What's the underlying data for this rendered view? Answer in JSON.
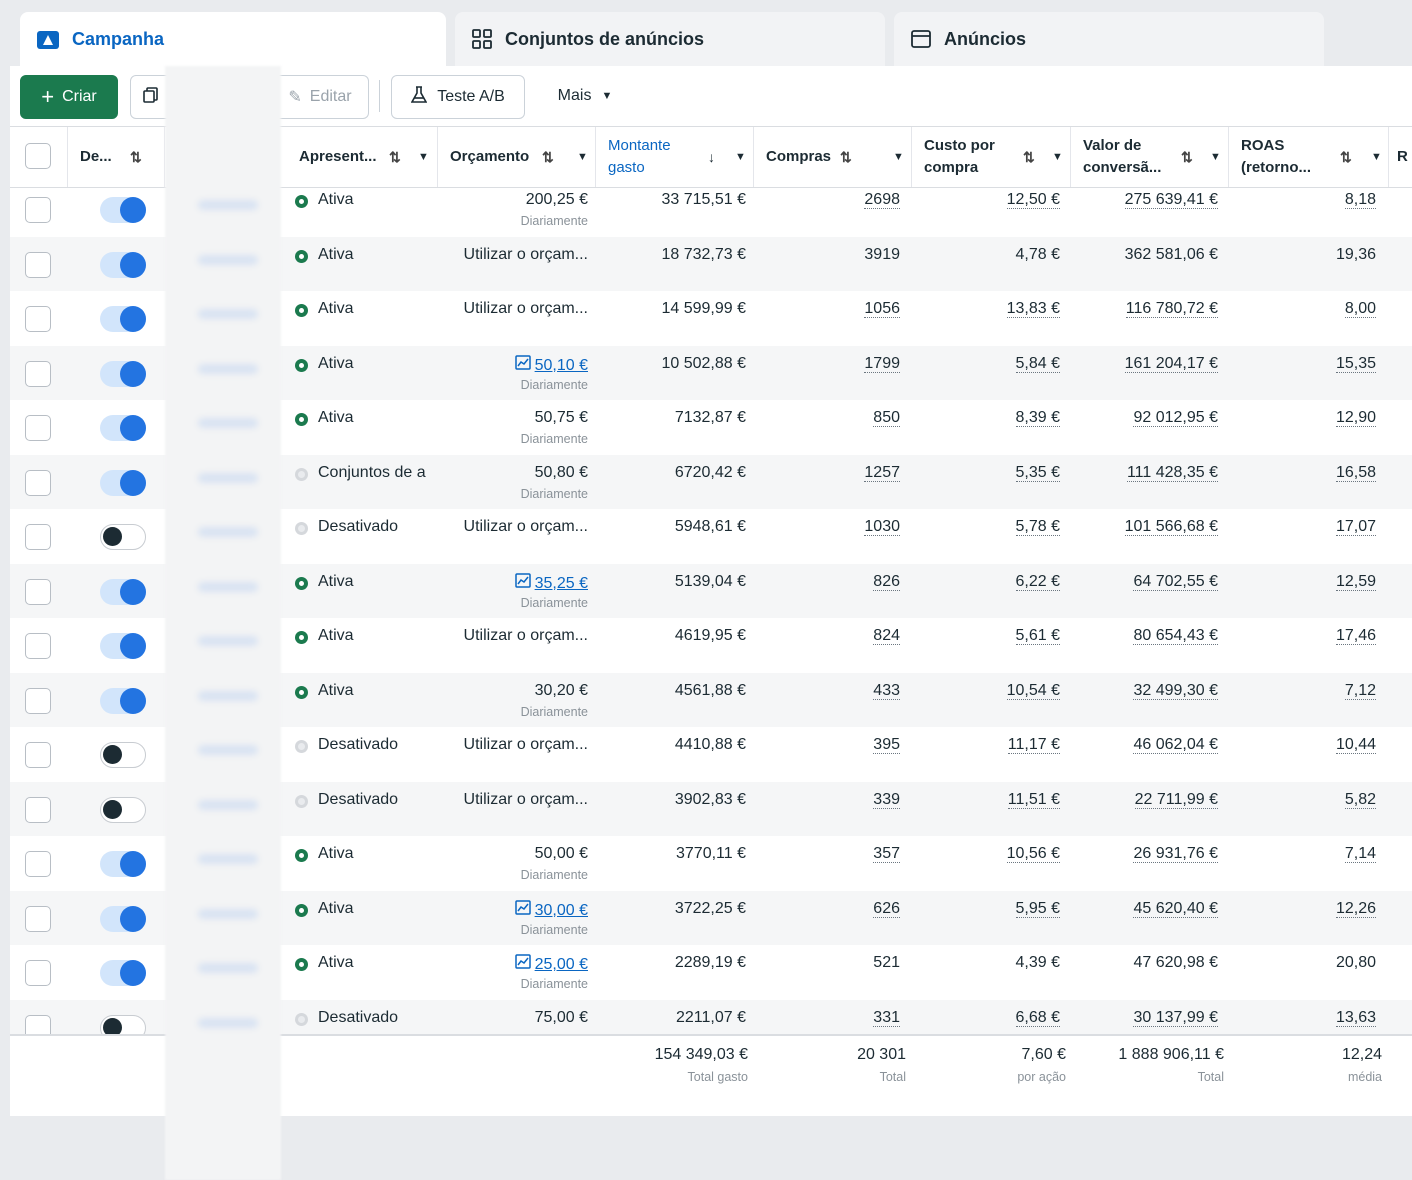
{
  "tabs": [
    {
      "label": "Campanha",
      "icon": "campaign-folder-icon",
      "active": true
    },
    {
      "label": "Conjuntos de anúncios",
      "icon": "grid-icon",
      "active": false
    },
    {
      "label": "Anúncios",
      "icon": "ad-window-icon",
      "active": false
    }
  ],
  "toolbar": {
    "create_label": "Criar",
    "edit_label": "Editar",
    "ab_test_label": "Teste A/B",
    "more_label": "Mais"
  },
  "columns": {
    "delivery_toggle": "De...",
    "status": "Apresent...",
    "budget": "Orçamento",
    "amount_spent_line1": "Montante",
    "amount_spent_line2": "gasto",
    "purchases": "Compras",
    "cost_per_purchase_line1": "Custo por",
    "cost_per_purchase_line2": "compra",
    "conversion_value_line1": "Valor de",
    "conversion_value_line2": "conversã...",
    "roas_line1": "ROAS",
    "roas_line2": "(retorno...",
    "cut_column": "R"
  },
  "colors": {
    "accent": "#0a66c2",
    "create_button": "#1b7a4e",
    "toggle_on": "#2374e1"
  },
  "rows": [
    {
      "on": true,
      "status": "Ativa",
      "status_type": "active",
      "budget": "200,25 €",
      "budget_sub": "Diariamente",
      "budget_link": false,
      "spent": "33 715,51 €",
      "purchases": "2698",
      "cpp": "12,50 €",
      "value": "275 639,41 €",
      "roas": "8,18",
      "u": true
    },
    {
      "on": true,
      "status": "Ativa",
      "status_type": "active",
      "budget": "Utilizar o orçam...",
      "budget_sub": "",
      "budget_link": false,
      "spent": "18 732,73 €",
      "purchases": "3919",
      "cpp": "4,78 €",
      "value": "362 581,06 €",
      "roas": "19,36",
      "u": false
    },
    {
      "on": true,
      "status": "Ativa",
      "status_type": "active",
      "budget": "Utilizar o orçam...",
      "budget_sub": "",
      "budget_link": false,
      "spent": "14 599,99 €",
      "purchases": "1056",
      "cpp": "13,83 €",
      "value": "116 780,72 €",
      "roas": "8,00",
      "u": true
    },
    {
      "on": true,
      "status": "Ativa",
      "status_type": "active",
      "budget": "50,10 €",
      "budget_sub": "Diariamente",
      "budget_link": true,
      "spent": "10 502,88 €",
      "purchases": "1799",
      "cpp": "5,84 €",
      "value": "161 204,17 €",
      "roas": "15,35",
      "u": true
    },
    {
      "on": true,
      "status": "Ativa",
      "status_type": "active",
      "budget": "50,75 €",
      "budget_sub": "Diariamente",
      "budget_link": false,
      "spent": "7132,87 €",
      "purchases": "850",
      "cpp": "8,39 €",
      "value": "92 012,95 €",
      "roas": "12,90",
      "u": true
    },
    {
      "on": true,
      "status": "Conjuntos de a",
      "status_type": "off",
      "budget": "50,80 €",
      "budget_sub": "Diariamente",
      "budget_link": false,
      "spent": "6720,42 €",
      "purchases": "1257",
      "cpp": "5,35 €",
      "value": "111 428,35 €",
      "roas": "16,58",
      "u": true
    },
    {
      "on": false,
      "status": "Desativado",
      "status_type": "off",
      "budget": "Utilizar o orçam...",
      "budget_sub": "",
      "budget_link": false,
      "spent": "5948,61 €",
      "purchases": "1030",
      "cpp": "5,78 €",
      "value": "101 566,68 €",
      "roas": "17,07",
      "u": true
    },
    {
      "on": true,
      "status": "Ativa",
      "status_type": "active",
      "budget": "35,25 €",
      "budget_sub": "Diariamente",
      "budget_link": true,
      "spent": "5139,04 €",
      "purchases": "826",
      "cpp": "6,22 €",
      "value": "64 702,55 €",
      "roas": "12,59",
      "u": true
    },
    {
      "on": true,
      "status": "Ativa",
      "status_type": "active",
      "budget": "Utilizar o orçam...",
      "budget_sub": "",
      "budget_link": false,
      "spent": "4619,95 €",
      "purchases": "824",
      "cpp": "5,61 €",
      "value": "80 654,43 €",
      "roas": "17,46",
      "u": true
    },
    {
      "on": true,
      "status": "Ativa",
      "status_type": "active",
      "budget": "30,20 €",
      "budget_sub": "Diariamente",
      "budget_link": false,
      "spent": "4561,88 €",
      "purchases": "433",
      "cpp": "10,54 €",
      "value": "32 499,30 €",
      "roas": "7,12",
      "u": true
    },
    {
      "on": false,
      "status": "Desativado",
      "status_type": "off",
      "budget": "Utilizar o orçam...",
      "budget_sub": "",
      "budget_link": false,
      "spent": "4410,88 €",
      "purchases": "395",
      "cpp": "11,17 €",
      "value": "46 062,04 €",
      "roas": "10,44",
      "u": true
    },
    {
      "on": false,
      "status": "Desativado",
      "status_type": "off",
      "budget": "Utilizar o orçam...",
      "budget_sub": "",
      "budget_link": false,
      "spent": "3902,83 €",
      "purchases": "339",
      "cpp": "11,51 €",
      "value": "22 711,99 €",
      "roas": "5,82",
      "u": true
    },
    {
      "on": true,
      "status": "Ativa",
      "status_type": "active",
      "budget": "50,00 €",
      "budget_sub": "Diariamente",
      "budget_link": false,
      "spent": "3770,11 €",
      "purchases": "357",
      "cpp": "10,56 €",
      "value": "26 931,76 €",
      "roas": "7,14",
      "u": true
    },
    {
      "on": true,
      "status": "Ativa",
      "status_type": "active",
      "budget": "30,00 €",
      "budget_sub": "Diariamente",
      "budget_link": true,
      "spent": "3722,25 €",
      "purchases": "626",
      "cpp": "5,95 €",
      "value": "45 620,40 €",
      "roas": "12,26",
      "u": true
    },
    {
      "on": true,
      "status": "Ativa",
      "status_type": "active",
      "budget": "25,00 €",
      "budget_sub": "Diariamente",
      "budget_link": true,
      "spent": "2289,19 €",
      "purchases": "521",
      "cpp": "4,39 €",
      "value": "47 620,98 €",
      "roas": "20,80",
      "u": false
    },
    {
      "on": false,
      "status": "Desativado",
      "status_type": "off",
      "budget": "75,00 €",
      "budget_sub": "",
      "budget_link": false,
      "spent": "2211,07 €",
      "purchases": "331",
      "cpp": "6,68 €",
      "value": "30 137,99 €",
      "roas": "13,63",
      "u": true
    }
  ],
  "totals": {
    "spent": "154 349,03 €",
    "spent_label": "Total gasto",
    "purchases": "20 301",
    "purchases_label": "Total",
    "cpp": "7,60 €",
    "cpp_label": "por ação",
    "value": "1 888 906,11 €",
    "value_label": "Total",
    "roas": "12,24",
    "roas_label": "média"
  }
}
